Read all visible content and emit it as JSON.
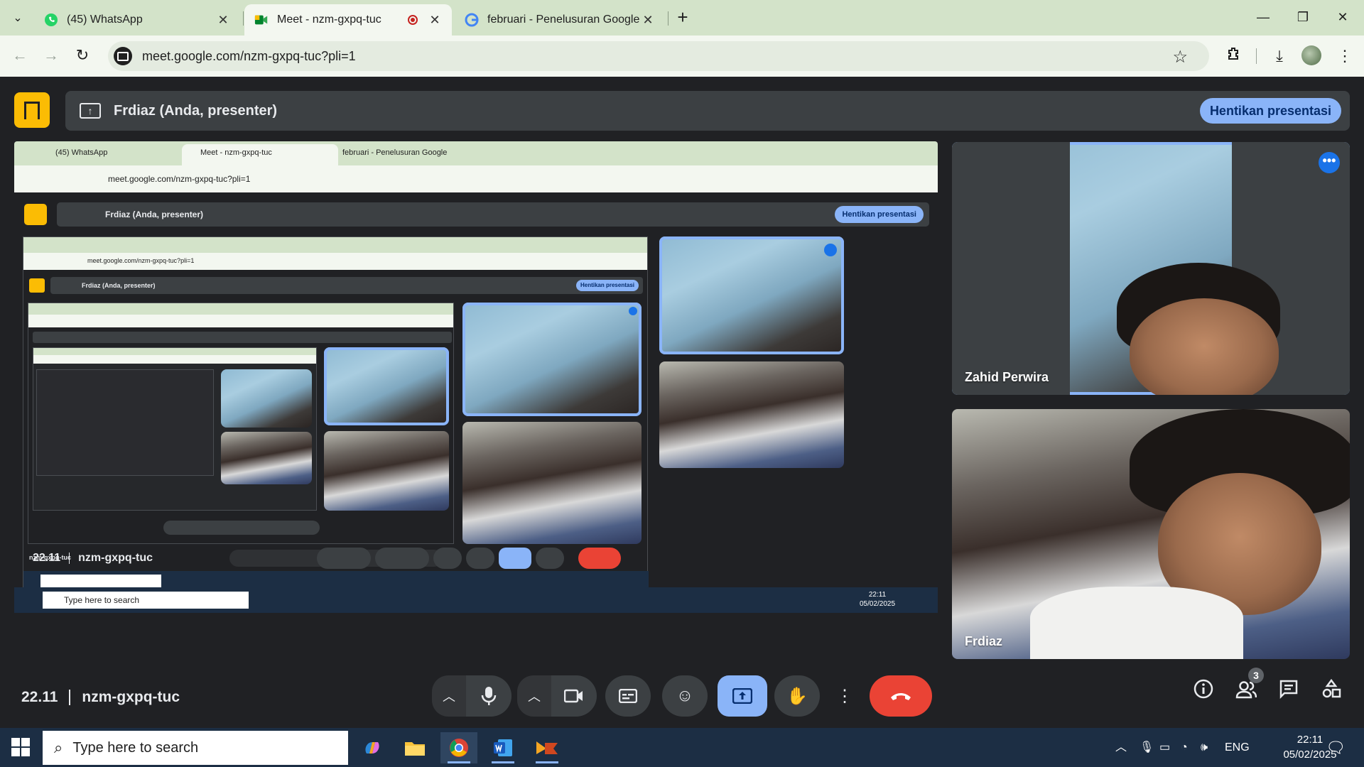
{
  "browser": {
    "tabs": [
      {
        "title": "(45) WhatsApp",
        "close": "✕"
      },
      {
        "title": "Meet - nzm-gxpq-tuc",
        "close": "✕"
      },
      {
        "title": "februari - Penelusuran Google",
        "close": "✕"
      }
    ],
    "new_tab": "+",
    "url": "meet.google.com/nzm-gxpq-tuc?pli=1"
  },
  "meet": {
    "presenting_text": "Frdiaz (Anda, presenter)",
    "stop_presenting_label": "Hentikan presentasi",
    "participants": [
      {
        "name": "Zahid Perwira"
      },
      {
        "name": "Frdiaz"
      }
    ],
    "time": "22.11",
    "meeting_code": "nzm-gxpq-tuc",
    "people_count": "3"
  },
  "taskbar": {
    "search_placeholder": "Type here to search",
    "language": "ENG",
    "clock_time": "22:11",
    "clock_date": "05/02/2025"
  },
  "colors": {
    "tabstrip": "#d3e3c9",
    "meet_background": "#202124",
    "accent_blue": "#8ab4f8",
    "end_call_red": "#ea4335",
    "meet_logo_yellow": "#fbbc04",
    "taskbar": "#1c2e44"
  },
  "icons": [
    "whatsapp-icon",
    "chrome-icon",
    "google-icon",
    "record-icon",
    "star-icon",
    "extensions-icon",
    "download-icon",
    "mic-icon",
    "camera-icon",
    "captions-icon",
    "emoji-icon",
    "present-icon",
    "raise-hand-icon",
    "more-options-icon",
    "end-call-icon",
    "info-icon",
    "people-icon",
    "chat-icon",
    "activities-icon",
    "windows-start-icon"
  ]
}
